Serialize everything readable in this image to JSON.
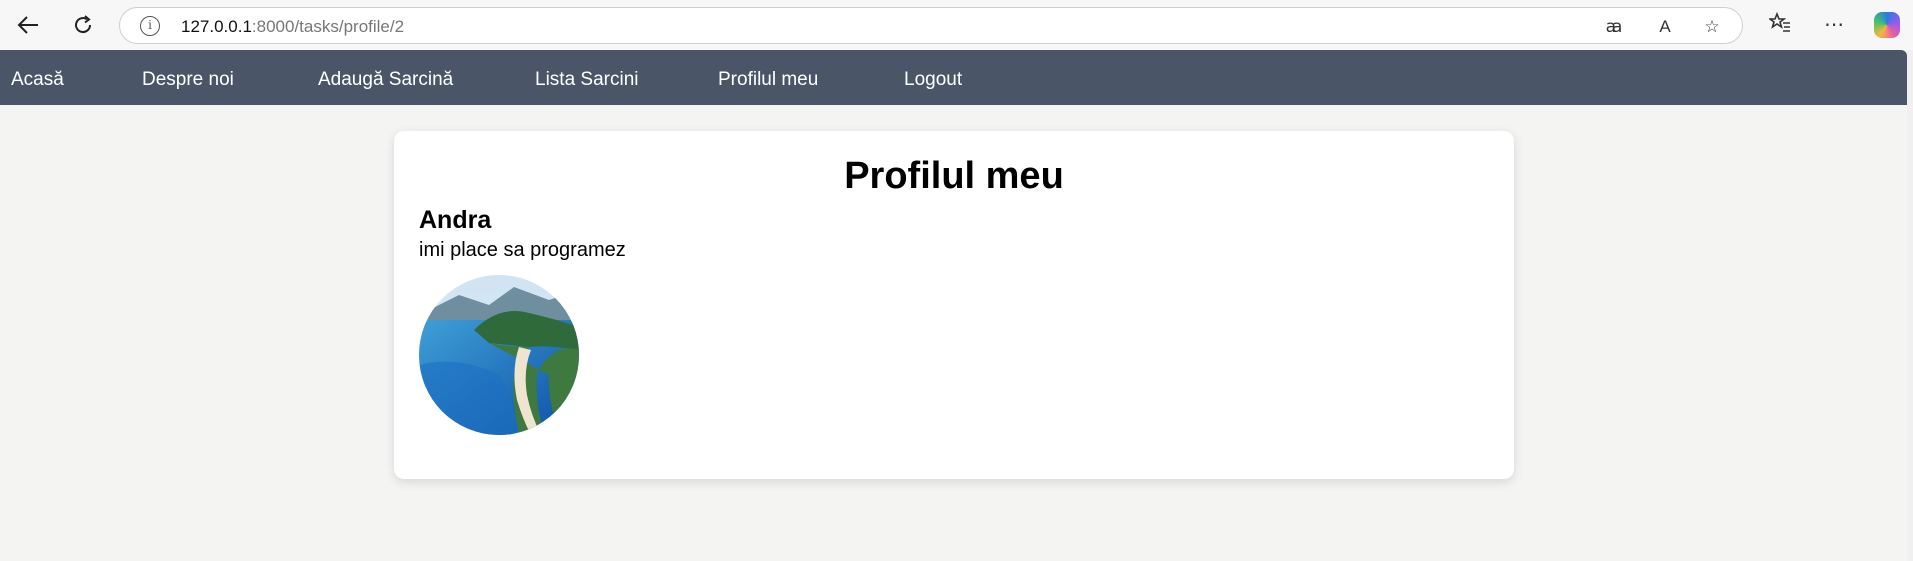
{
  "browser": {
    "url_host": "127.0.0.1",
    "url_rest": ":8000/tasks/profile/2",
    "icons": [
      "back-arrow-icon",
      "reload-icon",
      "site-info-icon",
      "translate-icon",
      "read-aloud-icon",
      "favorite-star-icon",
      "favorites-icon",
      "more-icon",
      "copilot-icon"
    ]
  },
  "nav": {
    "items": [
      {
        "label": "Acasă"
      },
      {
        "label": "Despre noi"
      },
      {
        "label": "Adaugă Sarcină"
      },
      {
        "label": "Lista Sarcini"
      },
      {
        "label": "Profilul meu"
      },
      {
        "label": "Logout"
      }
    ]
  },
  "profile": {
    "title": "Profilul meu",
    "name": "Andra",
    "bio": "imi place sa programez"
  },
  "colors": {
    "navbar": "#4a5568",
    "page_background": "#f4f4f3",
    "card_background": "#ffffff"
  }
}
